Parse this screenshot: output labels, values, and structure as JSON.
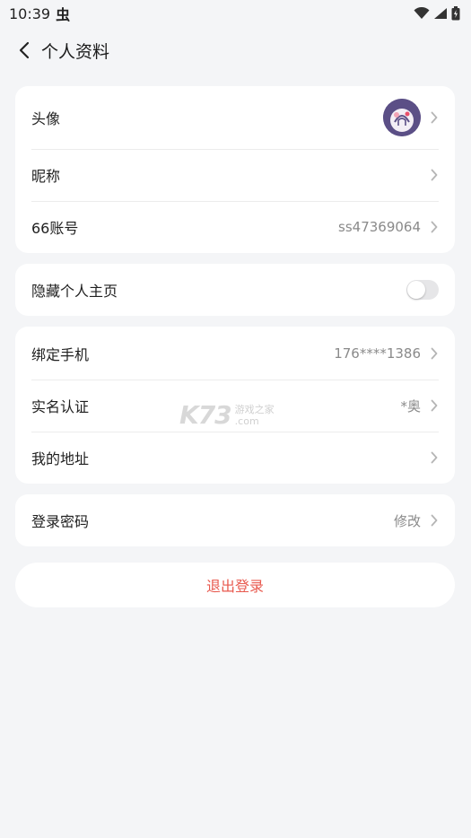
{
  "status_bar": {
    "time": "10:39",
    "app_badge": "虫"
  },
  "header": {
    "title": "个人资料"
  },
  "profile_card": {
    "avatar_label": "头像",
    "nickname_label": "昵称",
    "account_label": "66账号",
    "account_value": "ss47369064"
  },
  "privacy_card": {
    "hide_homepage_label": "隐藏个人主页",
    "hide_homepage_on": false
  },
  "binding_card": {
    "phone_label": "绑定手机",
    "phone_value": "176****1386",
    "realname_label": "实名认证",
    "realname_value": "*奥",
    "address_label": "我的地址"
  },
  "password_card": {
    "password_label": "登录密码",
    "password_action": "修改"
  },
  "logout_label": "退出登录",
  "watermark": {
    "big": "K73",
    "small_top": "游戏之家",
    "small_bottom": ".com"
  },
  "colors": {
    "background": "#f4f5f7",
    "card": "#ffffff",
    "logout_text": "#e85a4f",
    "secondary_text": "#8a8a8a"
  }
}
